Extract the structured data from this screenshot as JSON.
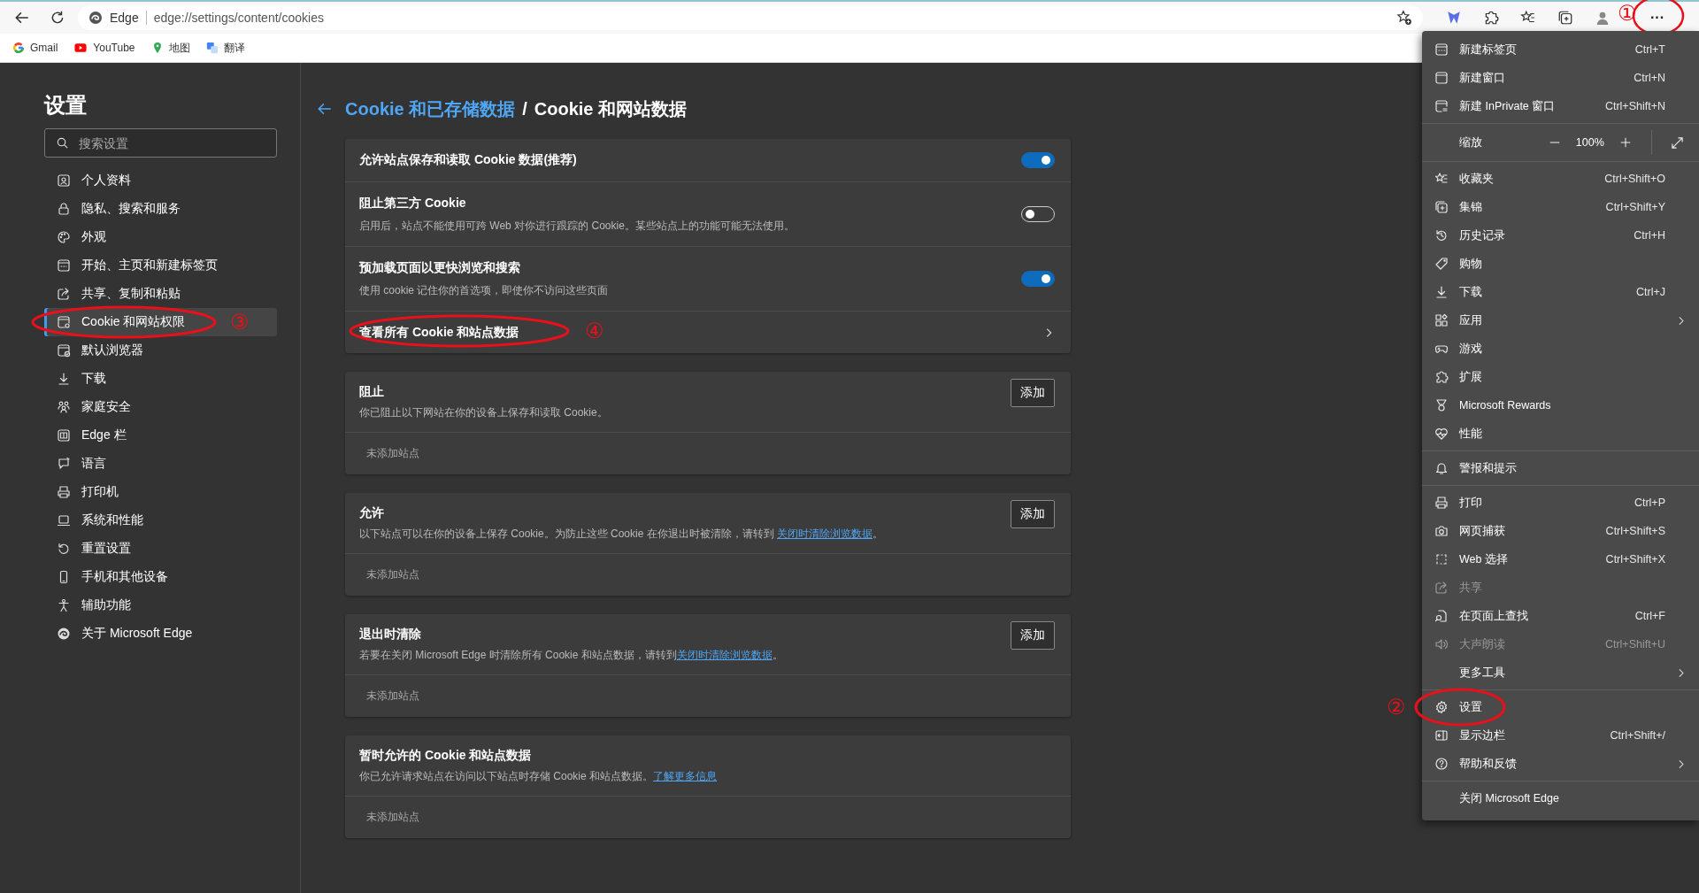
{
  "toolbar": {
    "site": "Edge",
    "url": "edge://settings/content/cookies",
    "more": "···",
    "annotation": "①"
  },
  "bookmarks": [
    {
      "label": "Gmail"
    },
    {
      "label": "YouTube"
    },
    {
      "label": "地图"
    },
    {
      "label": "翻译"
    }
  ],
  "sidebar": {
    "title": "设置",
    "search": {
      "placeholder": "搜索设置"
    },
    "items": [
      {
        "label": "个人资料",
        "selected": false
      },
      {
        "label": "隐私、搜索和服务",
        "selected": false
      },
      {
        "label": "外观",
        "selected": false
      },
      {
        "label": "开始、主页和新建标签页",
        "selected": false
      },
      {
        "label": "共享、复制和粘贴",
        "selected": false
      },
      {
        "label": "Cookie 和网站权限",
        "selected": true,
        "annotation": "③"
      },
      {
        "label": "默认浏览器",
        "selected": false
      },
      {
        "label": "下载",
        "selected": false
      },
      {
        "label": "家庭安全",
        "selected": false
      },
      {
        "label": "Edge 栏",
        "selected": false
      },
      {
        "label": "语言",
        "selected": false
      },
      {
        "label": "打印机",
        "selected": false
      },
      {
        "label": "系统和性能",
        "selected": false
      },
      {
        "label": "重置设置",
        "selected": false
      },
      {
        "label": "手机和其他设备",
        "selected": false
      },
      {
        "label": "辅助功能",
        "selected": false
      },
      {
        "label": "关于 Microsoft Edge",
        "selected": false
      }
    ]
  },
  "breadcrumb": {
    "parent": "Cookie 和已存储数据",
    "separator": "/",
    "current": "Cookie 和网站数据"
  },
  "cards": [
    {
      "kind": "settings",
      "rows": [
        {
          "kind": "toggle",
          "title": "允许站点保存和读取 Cookie 数据(推荐)",
          "on": true
        },
        {
          "kind": "toggle",
          "title": "阻止第三方 Cookie",
          "description": "启用后，站点不能使用可跨 Web 对你进行跟踪的 Cookie。某些站点上的功能可能无法使用。",
          "on": false
        },
        {
          "kind": "toggle",
          "title": "预加载页面以更快浏览和搜索",
          "description": "使用 cookie 记住你的首选项，即使你不访问这些页面",
          "on": true
        },
        {
          "kind": "link",
          "title": "查看所有 Cookie 和站点数据",
          "annotation": "④"
        }
      ]
    },
    {
      "kind": "list",
      "title": "阻止",
      "description": {
        "text": "你已阻止以下网站在你的设备上保存和读取 Cookie。"
      },
      "button": "添加",
      "empty": "未添加站点"
    },
    {
      "kind": "list",
      "title": "允许",
      "description": {
        "text": "以下站点可以在你的设备上保存 Cookie。为防止这些 Cookie 在你退出时被清除，请转到 ",
        "link": "关闭时清除浏览数据",
        "after": "。"
      },
      "button": "添加",
      "empty": "未添加站点"
    },
    {
      "kind": "list",
      "title": "退出时清除",
      "description": {
        "text": "若要在关闭 Microsoft Edge 时清除所有 Cookie 和站点数据，请转到",
        "link": "关闭时清除浏览数据",
        "after": "。"
      },
      "button": "添加",
      "empty": "未添加站点"
    },
    {
      "kind": "list",
      "title": "暂时允许的 Cookie 和站点数据",
      "description": {
        "text": "你已允许请求站点在访问以下站点时存储 Cookie 和站点数据。",
        "link": "了解更多信息"
      },
      "empty": "未添加站点"
    }
  ],
  "menu": {
    "sections": [
      {
        "items": [
          {
            "kind": "item",
            "label": "新建标签页",
            "shortcut": "Ctrl+T",
            "disabled": false
          },
          {
            "kind": "item",
            "label": "新建窗口",
            "shortcut": "Ctrl+N",
            "disabled": false
          },
          {
            "kind": "item",
            "label": "新建 InPrivate 窗口",
            "shortcut": "Ctrl+Shift+N",
            "disabled": false
          }
        ]
      },
      {
        "items": [
          {
            "kind": "zoom",
            "label": "缩放",
            "value": "100%"
          }
        ]
      },
      {
        "items": [
          {
            "kind": "item",
            "label": "收藏夹",
            "shortcut": "Ctrl+Shift+O",
            "disabled": false
          },
          {
            "kind": "item",
            "label": "集锦",
            "shortcut": "Ctrl+Shift+Y",
            "disabled": false
          },
          {
            "kind": "item",
            "label": "历史记录",
            "shortcut": "Ctrl+H",
            "disabled": false
          },
          {
            "kind": "item",
            "label": "购物",
            "disabled": false
          },
          {
            "kind": "item",
            "label": "下载",
            "shortcut": "Ctrl+J",
            "disabled": false
          },
          {
            "kind": "item",
            "label": "应用",
            "submenu": true,
            "disabled": false
          },
          {
            "kind": "item",
            "label": "游戏",
            "disabled": false
          },
          {
            "kind": "item",
            "label": "扩展",
            "disabled": false
          },
          {
            "kind": "item",
            "label": "Microsoft Rewards",
            "disabled": false
          },
          {
            "kind": "item",
            "label": "性能",
            "disabled": false
          }
        ]
      },
      {
        "items": [
          {
            "kind": "item",
            "label": "警报和提示",
            "disabled": false
          }
        ]
      },
      {
        "items": [
          {
            "kind": "item",
            "label": "打印",
            "shortcut": "Ctrl+P",
            "disabled": false
          },
          {
            "kind": "item",
            "label": "网页捕获",
            "shortcut": "Ctrl+Shift+S",
            "disabled": false
          },
          {
            "kind": "item",
            "label": "Web 选择",
            "shortcut": "Ctrl+Shift+X",
            "disabled": false
          },
          {
            "kind": "item",
            "label": "共享",
            "disabled": true
          },
          {
            "kind": "item",
            "label": "在页面上查找",
            "shortcut": "Ctrl+F",
            "disabled": false
          },
          {
            "kind": "item",
            "label": "大声朗读",
            "shortcut": "Ctrl+Shift+U",
            "disabled": true
          },
          {
            "kind": "item",
            "label": "更多工具",
            "submenu": true,
            "disabled": false
          }
        ]
      },
      {
        "items": [
          {
            "kind": "item",
            "label": "设置",
            "disabled": false,
            "annotation": "②"
          },
          {
            "kind": "item",
            "label": "显示边栏",
            "shortcut": "Ctrl+Shift+/",
            "disabled": false
          },
          {
            "kind": "item",
            "label": "帮助和反馈",
            "submenu": true,
            "disabled": false
          }
        ]
      },
      {
        "items": [
          {
            "kind": "item",
            "label": "关闭 Microsoft Edge",
            "disabled": false
          }
        ]
      }
    ]
  }
}
